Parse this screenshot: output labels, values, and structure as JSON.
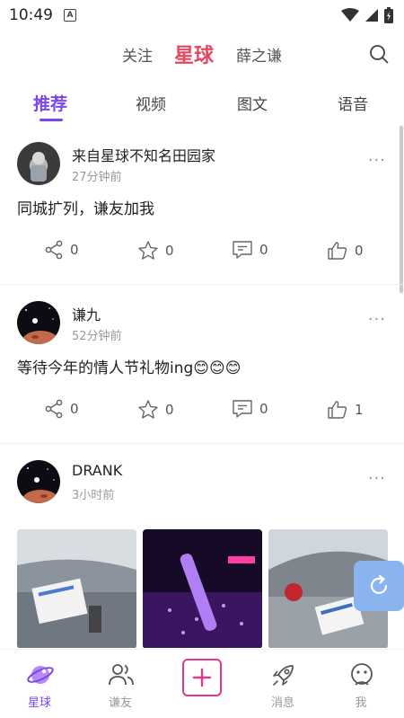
{
  "status_bar": {
    "time": "10:49",
    "notif_glyph": "A"
  },
  "top_nav": {
    "items": [
      "关注",
      "星球",
      "薛之谦"
    ],
    "active_index": 1
  },
  "tabs": {
    "items": [
      "推荐",
      "视频",
      "图文",
      "语音"
    ],
    "active_index": 0
  },
  "posts": [
    {
      "author": "来自星球不知名田园家",
      "time": "27分钟前",
      "text": "同城扩列，谦友加我",
      "share_count": "0",
      "star_count": "0",
      "comment_count": "0",
      "like_count": "0"
    },
    {
      "author": "谦九",
      "time": "52分钟前",
      "text": "等待今年的情人节礼物ing😊😊😊",
      "share_count": "0",
      "star_count": "0",
      "comment_count": "0",
      "like_count": "1"
    },
    {
      "author": "DRANK",
      "time": "3小时前"
    }
  ],
  "bottom_nav": {
    "items": [
      "星球",
      "谦友",
      "",
      "消息",
      "我"
    ],
    "active_index": 0
  },
  "colors": {
    "accent_purple": "#7b46f0",
    "accent_red": "#e8465f",
    "refresh_blue": "#8ab4f0"
  }
}
